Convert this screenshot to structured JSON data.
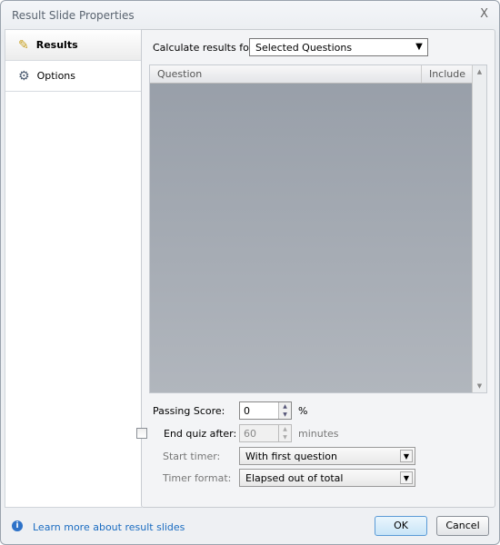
{
  "window": {
    "title": "Result Slide Properties",
    "close": "X"
  },
  "sidebar": {
    "items": [
      {
        "label": "Results",
        "icon": "pencil-icon",
        "active": true
      },
      {
        "label": "Options",
        "icon": "gear-icon",
        "active": false
      }
    ]
  },
  "results": {
    "calculate_label": "Calculate results for:",
    "calculate_value": "Selected Questions",
    "table": {
      "columns": [
        "Question",
        "Include"
      ],
      "rows": []
    },
    "passing_score_label": "Passing Score:",
    "passing_score_value": "0",
    "passing_score_unit": "%",
    "end_quiz_label": "End quiz after:",
    "end_quiz_checked": false,
    "end_quiz_value": "60",
    "end_quiz_unit": "minutes",
    "start_timer_label": "Start timer:",
    "start_timer_value": "With first question",
    "timer_format_label": "Timer format:",
    "timer_format_value": "Elapsed out of total"
  },
  "footer": {
    "help_link": "Learn more about result slides",
    "ok": "OK",
    "cancel": "Cancel"
  }
}
